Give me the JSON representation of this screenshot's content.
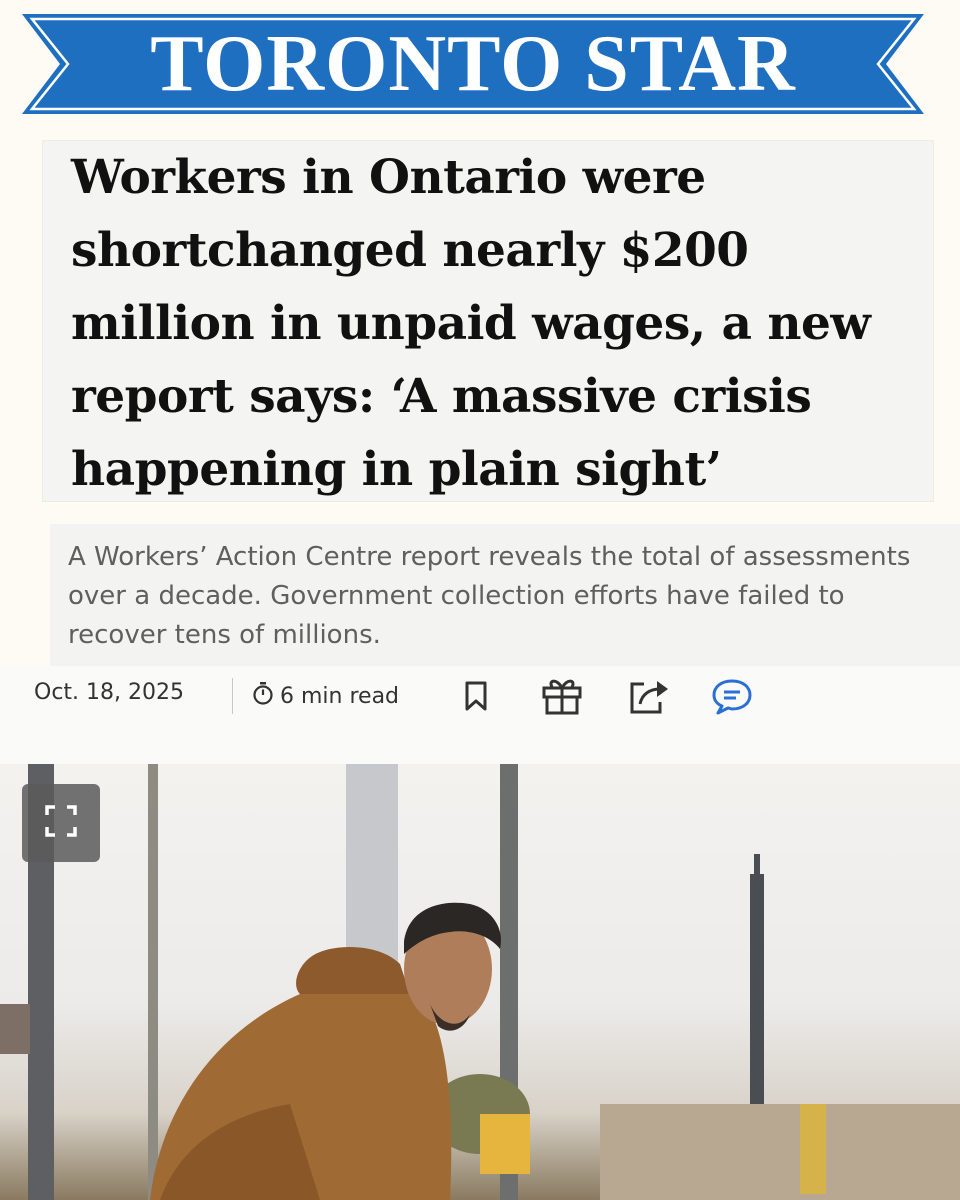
{
  "masthead": {
    "title": "TORONTO STAR",
    "color": "#1f6fc0"
  },
  "headline": "Workers in Ontario were shortchanged nearly $200 million in unpaid wages, a new report says: ‘A massive crisis happening in plain sight’",
  "dek": "A Workers’ Action Centre report reveals the total of assessments over a decade. Government collection efforts have failed to recover tens of millions.",
  "meta": {
    "date": "Oct. 18, 2025",
    "read_time": "6 min read",
    "icons": [
      "timer-icon",
      "bookmark-icon",
      "gift-icon",
      "share-icon",
      "comment-icon"
    ],
    "comment_color": "#2a6fd6"
  },
  "photo": {
    "icons": [
      "expand-icon"
    ]
  }
}
